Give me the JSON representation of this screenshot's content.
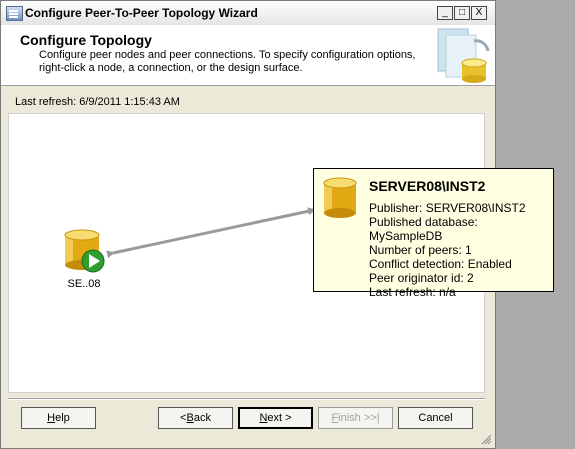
{
  "window": {
    "title": "Configure Peer-To-Peer Topology Wizard"
  },
  "titlebar_buttons": {
    "minimize": "_",
    "maximize": "□",
    "close": "X"
  },
  "header": {
    "title": "Configure Topology",
    "description": "Configure peer nodes and peer connections. To specify configuration options, right-click a node, a connection, or the design surface."
  },
  "status": {
    "last_refresh": "Last refresh: 6/9/2011 1:15:43 AM"
  },
  "nodes": [
    {
      "label": "SE..08",
      "icon": "database-play-icon"
    }
  ],
  "tooltip": {
    "title": "SERVER08\\INST2",
    "lines": [
      "Publisher: SERVER08\\INST2",
      "Published database: MySampleDB",
      "Number of peers: 1",
      "Conflict detection: Enabled",
      "Peer originator id: 2",
      "Last refresh: n/a"
    ]
  },
  "buttons": {
    "help": {
      "pre": "",
      "key": "H",
      "post": "elp"
    },
    "back": {
      "pre": "< ",
      "key": "B",
      "post": "ack"
    },
    "next": {
      "pre": "",
      "key": "N",
      "post": "ext >"
    },
    "finish": {
      "pre": "",
      "key": "F",
      "post": "inish >>|"
    },
    "cancel": {
      "pre": "Cancel",
      "key": "",
      "post": ""
    }
  },
  "colors": {
    "tooltip_bg": "#ffffe1",
    "database_gold": "#e0a800",
    "run_green": "#2e9e2e"
  }
}
